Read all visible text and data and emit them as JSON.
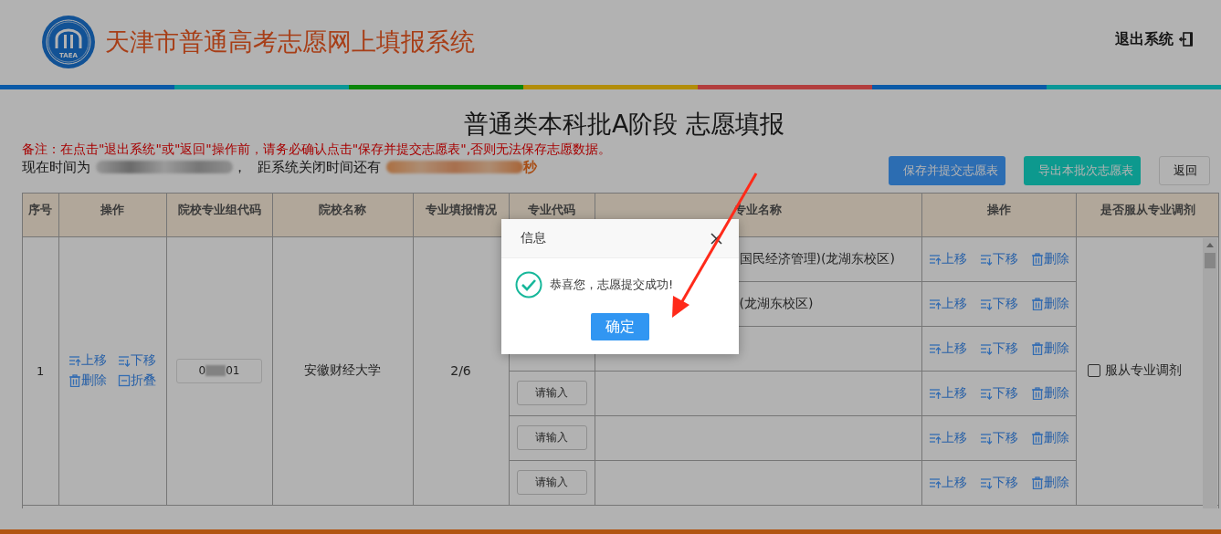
{
  "header": {
    "logo_text": "TAEA",
    "title": "天津市普通高考志愿网上填报系统",
    "logout": "退出系统"
  },
  "page_title": "普通类本科批A阶段 志愿填报",
  "notice": "备注：在点击\"退出系统\"或\"返回\"操作前，请务必确认点击\"保存并提交志愿表\",否则无法保存志愿数据。",
  "clock": {
    "label": "现在时间为",
    "separator": "，",
    "remaining_label": "距系统关闭时间还有",
    "remaining_suffix": "秒"
  },
  "buttons": [
    {
      "label": "保存并提交志愿表",
      "kind": "primary"
    },
    {
      "label": "导出本批次志愿表",
      "kind": "export"
    },
    {
      "label": "返回",
      "kind": "default"
    }
  ],
  "table": {
    "columns": [
      "序号",
      "操作",
      "院校专业组代码",
      "院校名称",
      "专业填报情况",
      "专业代码",
      "专业名称",
      "操作",
      "是否服从专业调剂"
    ],
    "groups": [
      {
        "index": "1",
        "actions": [
          {
            "label": "上移",
            "kind": "up"
          },
          {
            "label": "下移",
            "kind": "down"
          },
          {
            "label": "删除",
            "kind": "delete"
          },
          {
            "label": "折叠",
            "kind": "collapse"
          }
        ],
        "code_start": "0",
        "code_end": "01",
        "school": "安徽财经大学",
        "fill_status": "2/6",
        "majors": [
          {
            "name": "国民经济管理)(龙湖东校区)",
            "actions": [
              {
                "label": "上移",
                "kind": "up"
              },
              {
                "label": "下移",
                "kind": "down"
              },
              {
                "label": "删除",
                "kind": "delete"
              }
            ]
          },
          {
            "name": "(龙湖东校区)",
            "actions": [
              {
                "label": "上移",
                "kind": "up"
              },
              {
                "label": "下移",
                "kind": "down"
              },
              {
                "label": "删除",
                "kind": "delete"
              }
            ]
          },
          {
            "actions": [
              {
                "label": "上移",
                "kind": "up"
              },
              {
                "label": "下移",
                "kind": "down"
              },
              {
                "label": "删除",
                "kind": "delete"
              }
            ]
          },
          {
            "code_placeholder": "请输入",
            "actions": [
              {
                "label": "上移",
                "kind": "up"
              },
              {
                "label": "下移",
                "kind": "down"
              },
              {
                "label": "删除",
                "kind": "delete"
              }
            ]
          },
          {
            "code_placeholder": "请输入",
            "actions": [
              {
                "label": "上移",
                "kind": "up"
              },
              {
                "label": "下移",
                "kind": "down"
              },
              {
                "label": "删除",
                "kind": "delete"
              }
            ]
          },
          {
            "code_placeholder": "请输入",
            "actions": [
              {
                "label": "上移",
                "kind": "up"
              },
              {
                "label": "下移",
                "kind": "down"
              },
              {
                "label": "删除",
                "kind": "delete"
              }
            ]
          }
        ],
        "adjust": {
          "label": "服从专业调剂",
          "checked": false
        }
      }
    ]
  },
  "dialog": {
    "title": "信息",
    "message": "恭喜您，志愿提交成功!",
    "confirm": "确定"
  }
}
